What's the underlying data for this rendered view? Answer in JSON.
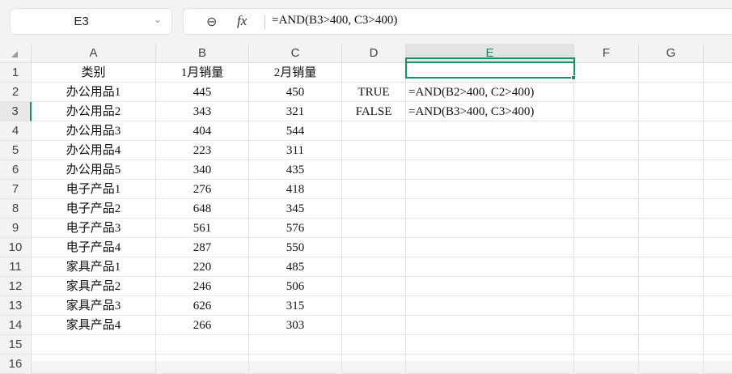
{
  "name_box": {
    "value": "E3"
  },
  "formula_bar": {
    "formula": "=AND(B3>400, C3>400)"
  },
  "columns": [
    "A",
    "B",
    "C",
    "D",
    "E",
    "F",
    "G",
    ""
  ],
  "selected_column": "E",
  "selected_row": 3,
  "rows": [
    [
      "类别",
      "1月销量",
      "2月销量",
      "",
      "",
      "",
      "",
      ""
    ],
    [
      "办公用品1",
      "445",
      "450",
      "TRUE",
      "=AND(B2>400, C2>400)",
      "",
      "",
      ""
    ],
    [
      "办公用品2",
      "343",
      "321",
      "FALSE",
      "=AND(B3>400, C3>400)",
      "",
      "",
      ""
    ],
    [
      "办公用品3",
      "404",
      "544",
      "",
      "",
      "",
      "",
      ""
    ],
    [
      "办公用品4",
      "223",
      "311",
      "",
      "",
      "",
      "",
      ""
    ],
    [
      "办公用品5",
      "340",
      "435",
      "",
      "",
      "",
      "",
      ""
    ],
    [
      "电子产品1",
      "276",
      "418",
      "",
      "",
      "",
      "",
      ""
    ],
    [
      "电子产品2",
      "648",
      "345",
      "",
      "",
      "",
      "",
      ""
    ],
    [
      "电子产品3",
      "561",
      "576",
      "",
      "",
      "",
      "",
      ""
    ],
    [
      "电子产品4",
      "287",
      "550",
      "",
      "",
      "",
      "",
      ""
    ],
    [
      "家具产品1",
      "220",
      "485",
      "",
      "",
      "",
      "",
      ""
    ],
    [
      "家具产品2",
      "246",
      "506",
      "",
      "",
      "",
      "",
      ""
    ],
    [
      "家具产品3",
      "626",
      "315",
      "",
      "",
      "",
      "",
      ""
    ],
    [
      "家具产品4",
      "266",
      "303",
      "",
      "",
      "",
      "",
      ""
    ],
    [
      "",
      "",
      "",
      "",
      "",
      "",
      "",
      ""
    ],
    [
      "",
      "",
      "",
      "",
      "",
      "",
      "",
      ""
    ]
  ],
  "row_numbers": [
    "1",
    "2",
    "3",
    "4",
    "5",
    "6",
    "7",
    "8",
    "9",
    "10",
    "11",
    "12",
    "13",
    "14",
    "15",
    "16"
  ]
}
